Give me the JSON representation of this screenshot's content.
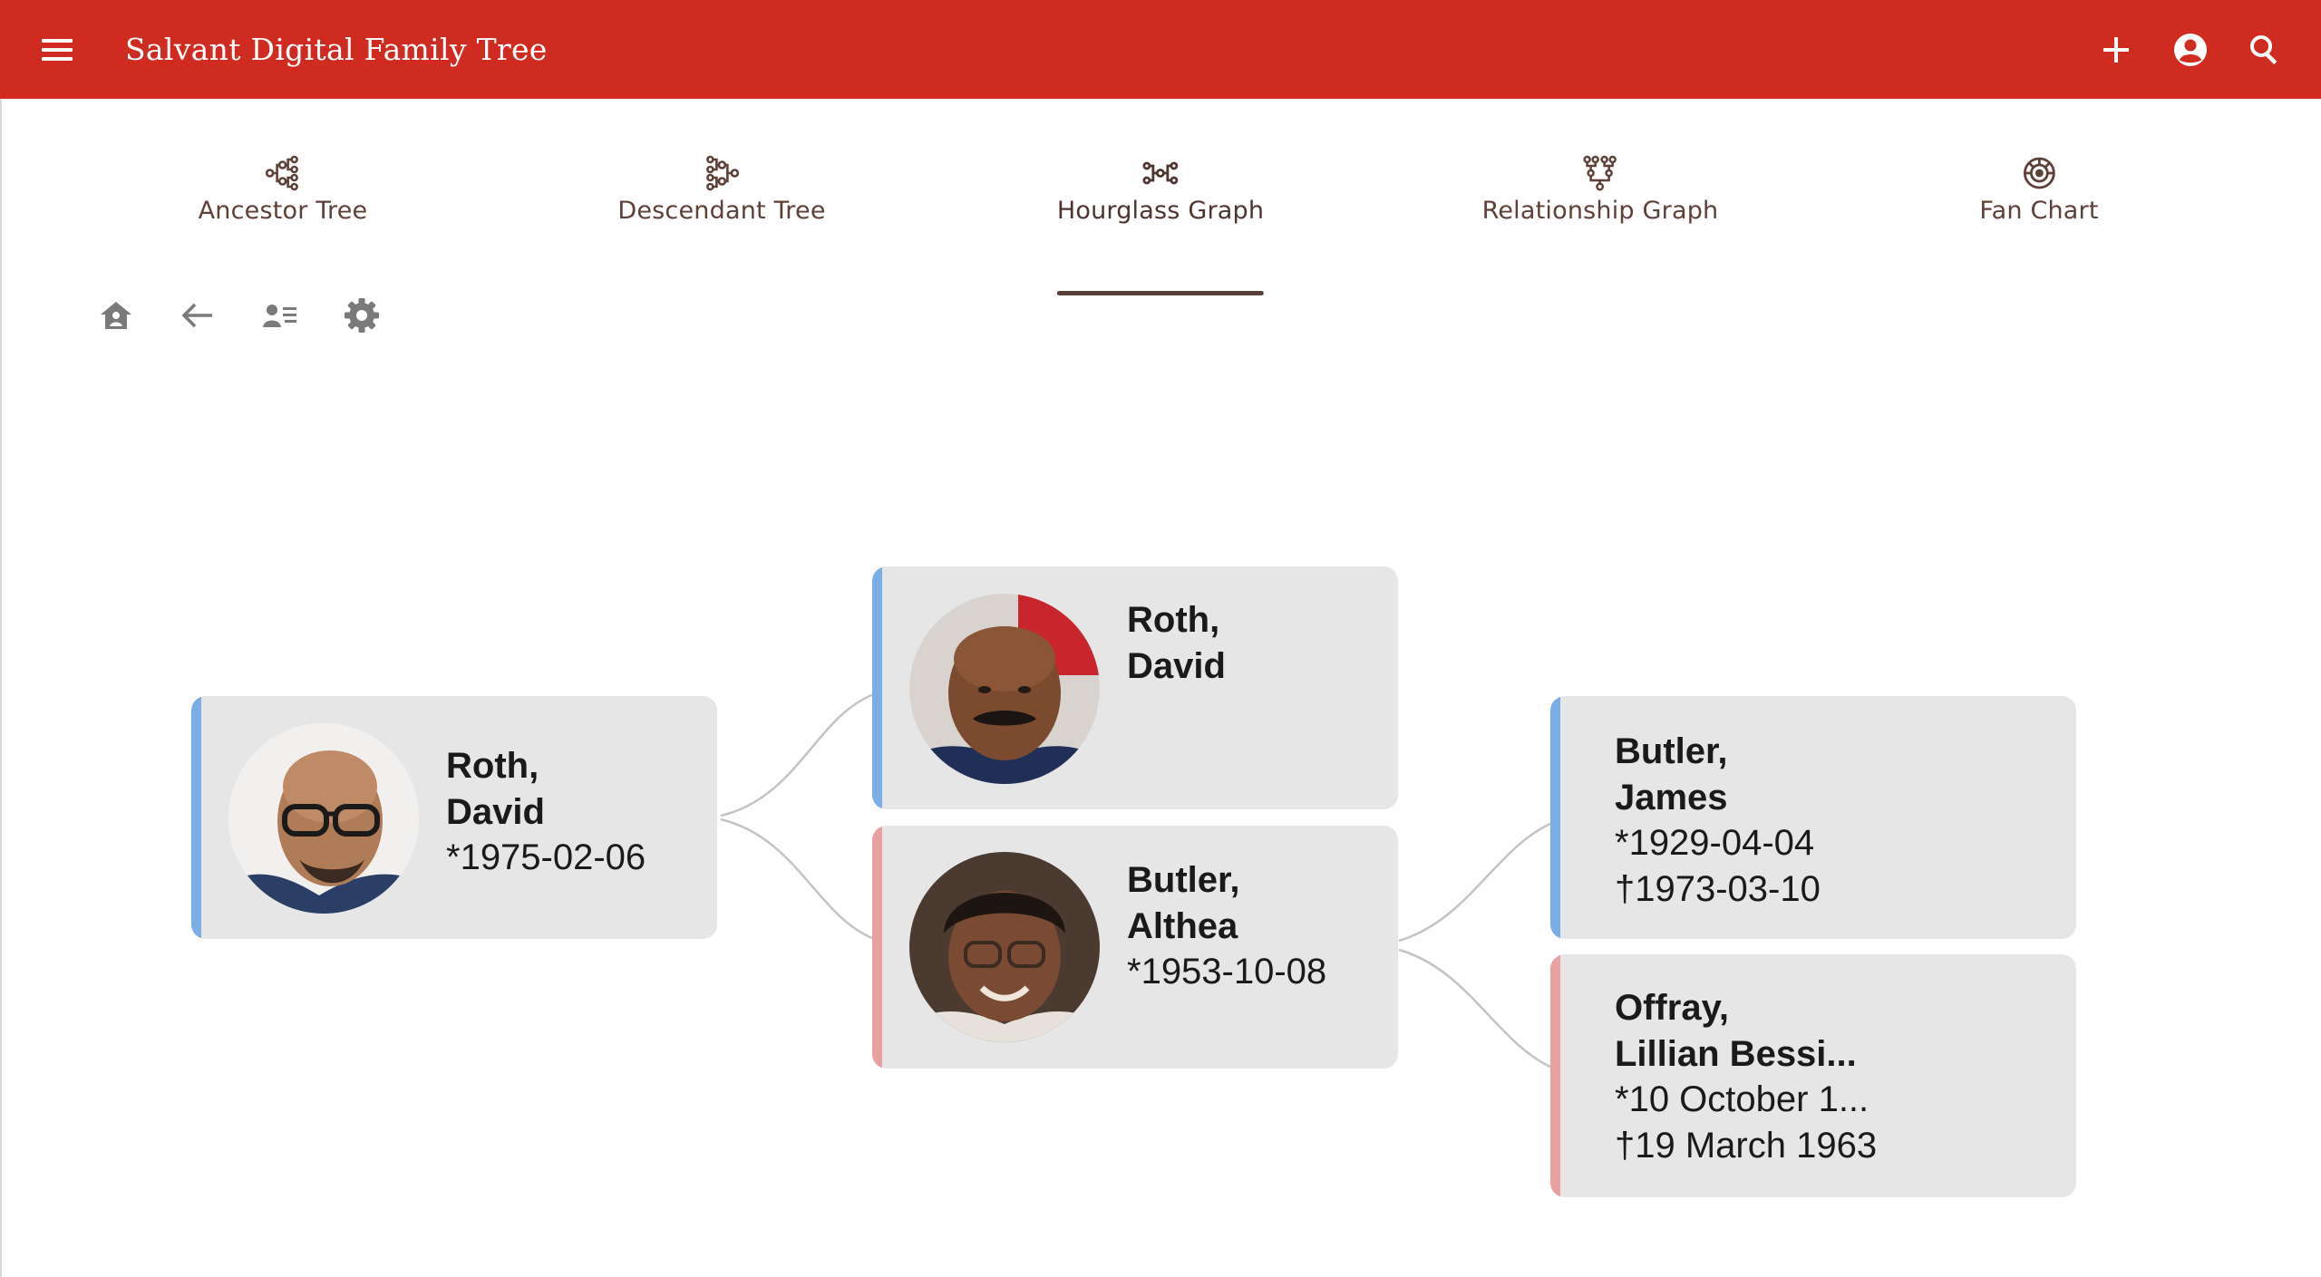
{
  "app": {
    "title": "Salvant Digital Family Tree",
    "bar_color": "#cf2b20",
    "icons": {
      "menu": "hamburger-menu-icon",
      "add": "plus-icon",
      "account": "account-circle-icon",
      "search": "search-icon"
    }
  },
  "tabs": [
    {
      "label": "Ancestor Tree",
      "icon": "ancestor-tree-icon",
      "active": false
    },
    {
      "label": "Descendant Tree",
      "icon": "descendant-tree-icon",
      "active": false
    },
    {
      "label": "Hourglass Graph",
      "icon": "hourglass-graph-icon",
      "active": true
    },
    {
      "label": "Relationship Graph",
      "icon": "relationship-graph-icon",
      "active": false
    },
    {
      "label": "Fan Chart",
      "icon": "fan-chart-icon",
      "active": false
    }
  ],
  "toolbar": {
    "icons": [
      "home-person-icon",
      "back-arrow-icon",
      "person-list-icon",
      "settings-gear-icon"
    ]
  },
  "colors": {
    "male": "#7aaee6",
    "female": "#e8a0a0",
    "card": "#e6e6e6",
    "link": "#c4c4c4"
  },
  "people": {
    "home": {
      "surname": "Roth,",
      "given": "David",
      "birth": "*1975-02-06",
      "death": "",
      "sex": "male"
    },
    "father": {
      "surname": "Roth,",
      "given": "David",
      "birth": "",
      "death": "",
      "sex": "male"
    },
    "mother": {
      "surname": "Butler,",
      "given": "Althea",
      "birth": "*1953-10-08",
      "death": "",
      "sex": "female"
    },
    "maternal_grandfather": {
      "surname": "Butler,",
      "given": "James",
      "birth": "*1929-04-04",
      "death": "†1973-03-10",
      "sex": "male"
    },
    "maternal_grandmother": {
      "surname": "Offray,",
      "given": "Lillian Bessi...",
      "birth": "*10 October 1...",
      "death": "†19 March 1963",
      "sex": "female"
    }
  }
}
